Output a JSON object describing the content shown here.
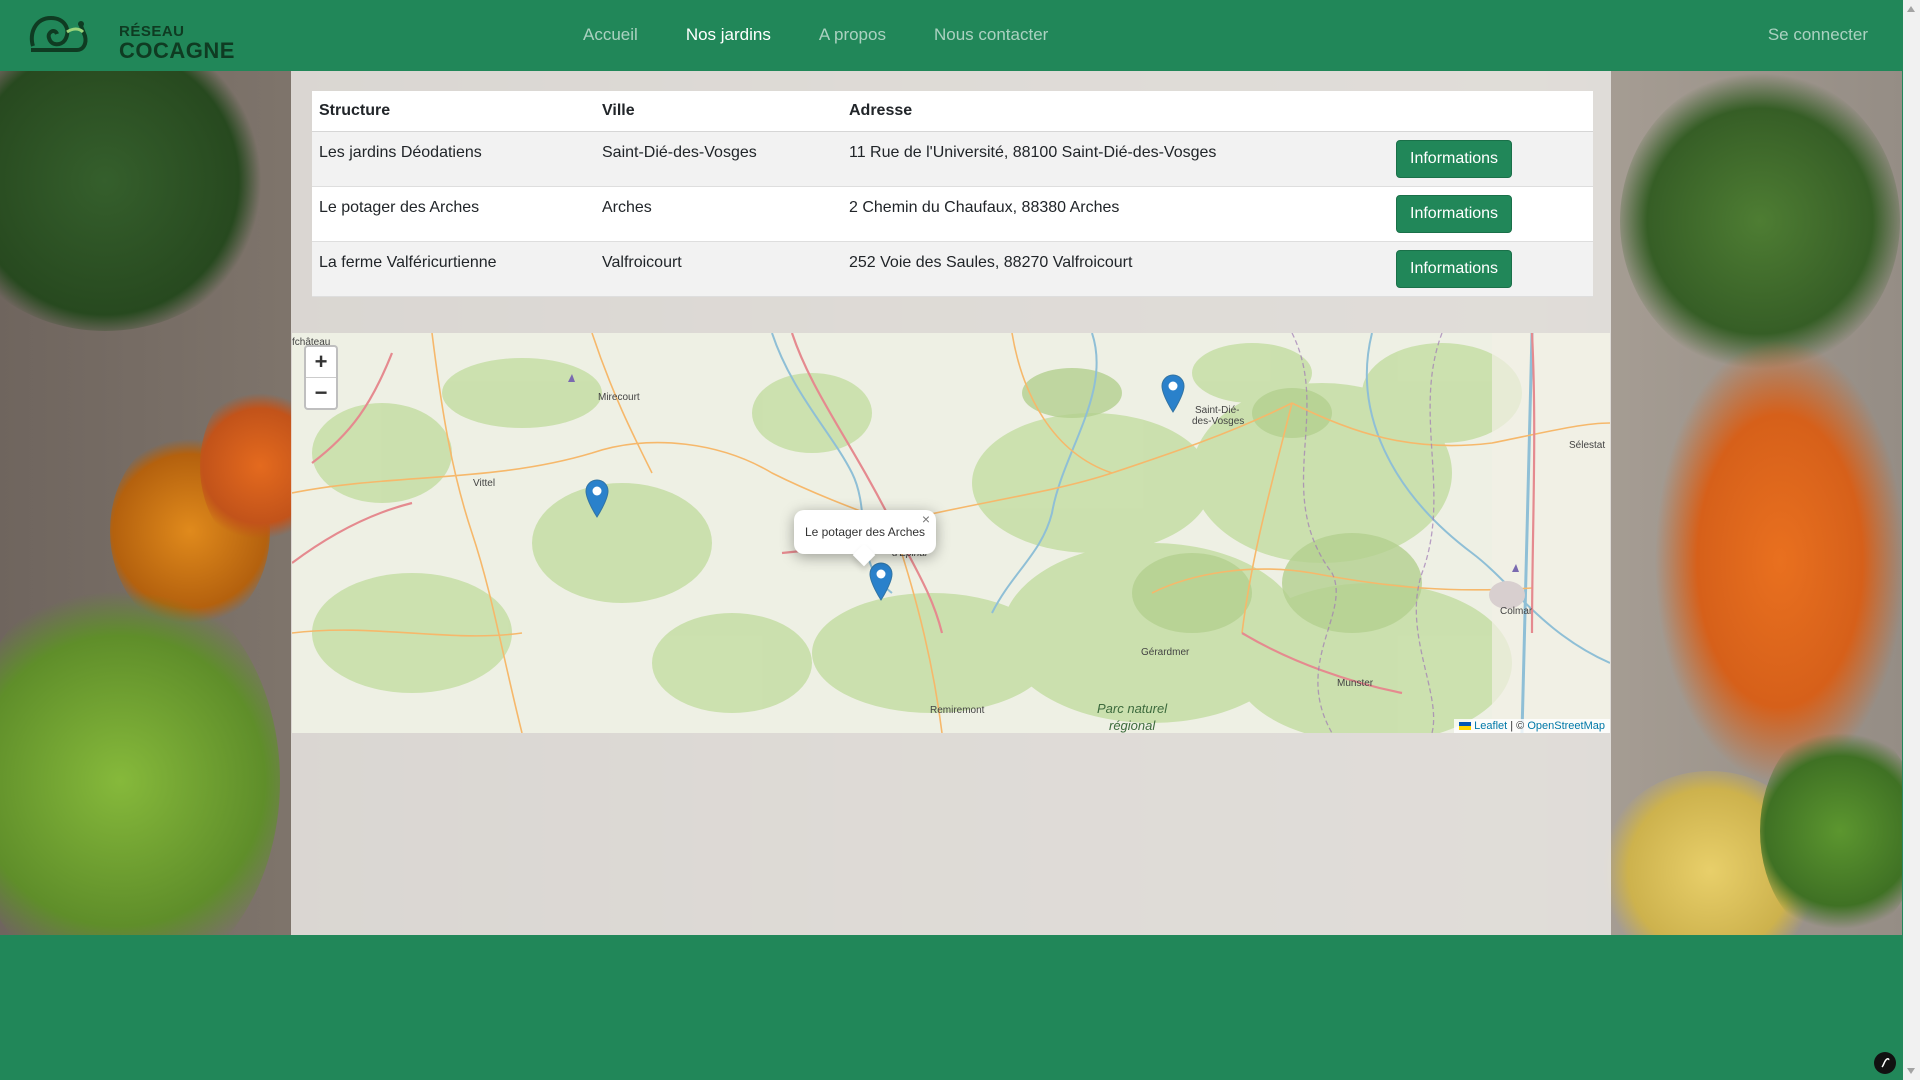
{
  "header": {
    "logo_top": "RÉSEAU",
    "logo_bottom": "COCAGNE",
    "nav": [
      {
        "label": "Accueil",
        "active": false
      },
      {
        "label": "Nos jardins",
        "active": true
      },
      {
        "label": "A propos",
        "active": false
      },
      {
        "label": "Nous contacter",
        "active": false
      }
    ],
    "login_label": "Se connecter"
  },
  "table": {
    "headers": [
      "Structure",
      "Ville",
      "Adresse",
      ""
    ],
    "rows": [
      {
        "structure": "Les jardins Déodatiens",
        "ville": "Saint-Dié-des-Vosges",
        "adresse": "11 Rue de l'Université, 88100 Saint-Dié-des-Vosges",
        "button": "Informations"
      },
      {
        "structure": "Le potager des Arches",
        "ville": "Arches",
        "adresse": "2 Chemin du Chaufaux, 88380 Arches",
        "button": "Informations"
      },
      {
        "structure": "La ferme Valféricurtienne",
        "ville": "Valfroicourt",
        "adresse": "252 Voie des Saules, 88270 Valfroicourt",
        "button": "Informations"
      }
    ]
  },
  "map": {
    "zoom_in": "+",
    "zoom_out": "−",
    "places": {
      "neufchateau": "fchâteau",
      "mirecourt": "Mirecourt",
      "vittel": "Vittel",
      "epinal": "d'Épinal",
      "saint_die_1": "Saint-Dié-",
      "saint_die_2": "des-Vosges",
      "selestat": "Sélestat",
      "colmar": "Colmar",
      "gerardmer": "Gérardmer",
      "munster": "Munster",
      "remiremont": "Remiremont",
      "parc_1": "Parc naturel",
      "parc_2": "régional"
    },
    "popup_text": "Le potager des Arches",
    "popup_close": "×",
    "attribution": {
      "leaflet": "Leaflet",
      "sep": "| ©",
      "osm": "OpenStreetMap"
    },
    "colors": {
      "marker": "#2a81cb",
      "water": "#aad3df",
      "forest": "#c8dfa9",
      "road": "#f6b86b"
    }
  },
  "colors": {
    "primary": "#218759"
  }
}
